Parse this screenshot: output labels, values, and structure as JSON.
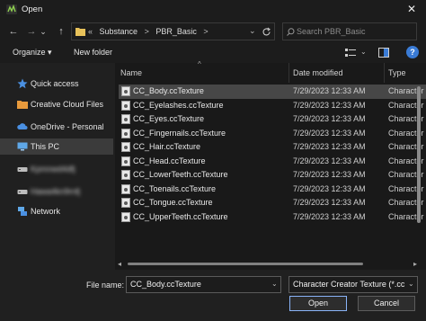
{
  "window": {
    "title": "Open",
    "close_glyph": "✕"
  },
  "nav": {
    "back_glyph": "←",
    "forward_glyph": "→",
    "dropdown_glyph": "⌄",
    "up_glyph": "↑",
    "breadcrumb": [
      "«",
      "Substance",
      ">",
      "PBR_Basic",
      ">"
    ],
    "refresh_glyph": "⌄",
    "search_placeholder": "Search PBR_Basic"
  },
  "toolbar": {
    "organize_label": "Organize ▾",
    "new_folder_label": "New folder",
    "help_glyph": "?"
  },
  "sidebar": {
    "items": [
      {
        "label": "Quick access",
        "icon": "star-icon"
      },
      {
        "label": "Creative Cloud Files",
        "icon": "folder-icon"
      },
      {
        "label": "OneDrive - Personal",
        "icon": "cloud-icon"
      },
      {
        "label": "This PC",
        "icon": "monitor-icon"
      },
      {
        "label": "Kpmnwd4dfj",
        "icon": "drive-icon"
      },
      {
        "label": "Hawa4kn9rnfj",
        "icon": "drive-icon"
      },
      {
        "label": "Network",
        "icon": "network-icon"
      }
    ],
    "active_index": 3
  },
  "filelist": {
    "columns": {
      "name": "Name",
      "date": "Date modified",
      "type": "Type"
    },
    "rows": [
      {
        "name": "CC_Body.ccTexture",
        "date": "7/29/2023 12:33 AM",
        "type": "Charactor"
      },
      {
        "name": "CC_Eyelashes.ccTexture",
        "date": "7/29/2023 12:33 AM",
        "type": "Charactor"
      },
      {
        "name": "CC_Eyes.ccTexture",
        "date": "7/29/2023 12:33 AM",
        "type": "Charactor"
      },
      {
        "name": "CC_Fingernails.ccTexture",
        "date": "7/29/2023 12:33 AM",
        "type": "Charactor"
      },
      {
        "name": "CC_Hair.ccTexture",
        "date": "7/29/2023 12:33 AM",
        "type": "Charactor"
      },
      {
        "name": "CC_Head.ccTexture",
        "date": "7/29/2023 12:33 AM",
        "type": "Charactor"
      },
      {
        "name": "CC_LowerTeeth.ccTexture",
        "date": "7/29/2023 12:33 AM",
        "type": "Charactor"
      },
      {
        "name": "CC_Toenails.ccTexture",
        "date": "7/29/2023 12:33 AM",
        "type": "Charactor"
      },
      {
        "name": "CC_Tongue.ccTexture",
        "date": "7/29/2023 12:33 AM",
        "type": "Charactor"
      },
      {
        "name": "CC_UpperTeeth.ccTexture",
        "date": "7/29/2023 12:33 AM",
        "type": "Charactor"
      }
    ],
    "selected_index": 0
  },
  "bottom": {
    "file_name_label": "File name:",
    "file_name_value": "CC_Body.ccTexture",
    "file_type_value": "Character Creator Texture (*.cc",
    "open_label": "Open",
    "cancel_label": "Cancel",
    "caret_glyph": "⌄"
  },
  "colors": {
    "background": "#202020",
    "list_background": "#191919",
    "selection": "#474747",
    "accent": "#8ab4f8",
    "help_blue": "#3a7bd5"
  }
}
